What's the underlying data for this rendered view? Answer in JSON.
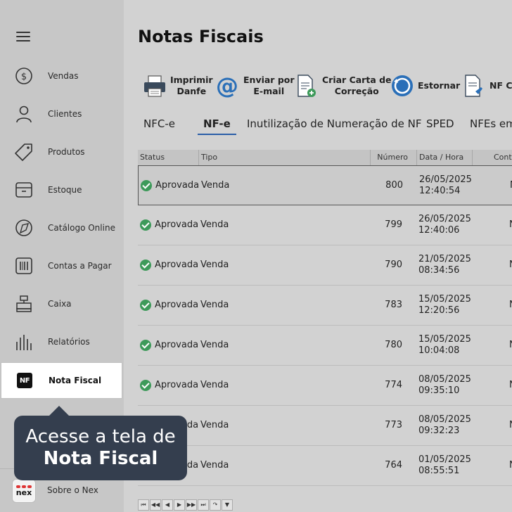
{
  "sidebar": {
    "items": [
      {
        "label": "Vendas",
        "icon": "dollar-circle-icon"
      },
      {
        "label": "Clientes",
        "icon": "user-icon"
      },
      {
        "label": "Produtos",
        "icon": "tag-icon"
      },
      {
        "label": "Estoque",
        "icon": "box-icon"
      },
      {
        "label": "Catálogo Online",
        "icon": "catalog-icon"
      },
      {
        "label": "Contas a Pagar",
        "icon": "barcode-icon"
      },
      {
        "label": "Caixa",
        "icon": "cash-register-icon"
      },
      {
        "label": "Relatórios",
        "icon": "bar-chart-icon"
      },
      {
        "label": "Nota Fiscal",
        "icon": "nf-icon",
        "badge": "NF"
      }
    ],
    "about": {
      "label": "Sobre o Nex",
      "logo_text": "nex"
    }
  },
  "tooltip": {
    "line1": "Acesse a tela de",
    "line2": "Nota Fiscal"
  },
  "page": {
    "title": "Notas Fiscais"
  },
  "toolbar": {
    "imprimir": "Imprimir\nDanfe",
    "enviar": "Enviar por\nE-mail",
    "carta": "Criar Carta de\nCorreção",
    "estornar": "Estornar",
    "nf_comp": "NF Co"
  },
  "tabs": [
    "NFC-e",
    "NF-e",
    "Inutilização de Numeração de NF",
    "SPED",
    "NFEs em"
  ],
  "table": {
    "headers": [
      "Status",
      "Tipo",
      "Número",
      "Data / Hora",
      "Cont"
    ],
    "rows": [
      {
        "status": "Aprovada",
        "tipo": "Venda",
        "numero": "800",
        "data": "26/05/2025",
        "hora": "12:40:54",
        "cont": "N"
      },
      {
        "status": "Aprovada",
        "tipo": "Venda",
        "numero": "799",
        "data": "26/05/2025",
        "hora": "12:40:06",
        "cont": "N"
      },
      {
        "status": "Aprovada",
        "tipo": "Venda",
        "numero": "790",
        "data": "21/05/2025",
        "hora": "08:34:56",
        "cont": "N"
      },
      {
        "status": "Aprovada",
        "tipo": "Venda",
        "numero": "783",
        "data": "15/05/2025",
        "hora": "12:20:56",
        "cont": "N"
      },
      {
        "status": "Aprovada",
        "tipo": "Venda",
        "numero": "780",
        "data": "15/05/2025",
        "hora": "10:04:08",
        "cont": "N"
      },
      {
        "status": "Aprovada",
        "tipo": "Venda",
        "numero": "774",
        "data": "08/05/2025",
        "hora": "09:35:10",
        "cont": "N"
      },
      {
        "status": "Aprovada",
        "tipo": "Venda",
        "numero": "773",
        "data": "08/05/2025",
        "hora": "09:32:23",
        "cont": "N"
      },
      {
        "status": "Aprovada",
        "tipo": "Venda",
        "numero": "764",
        "data": "01/05/2025",
        "hora": "08:55:51",
        "cont": "N"
      }
    ]
  },
  "pager": [
    "⏮",
    "◀◀",
    "◀",
    "▶",
    "▶▶",
    "⏭",
    "↷",
    "▼"
  ]
}
